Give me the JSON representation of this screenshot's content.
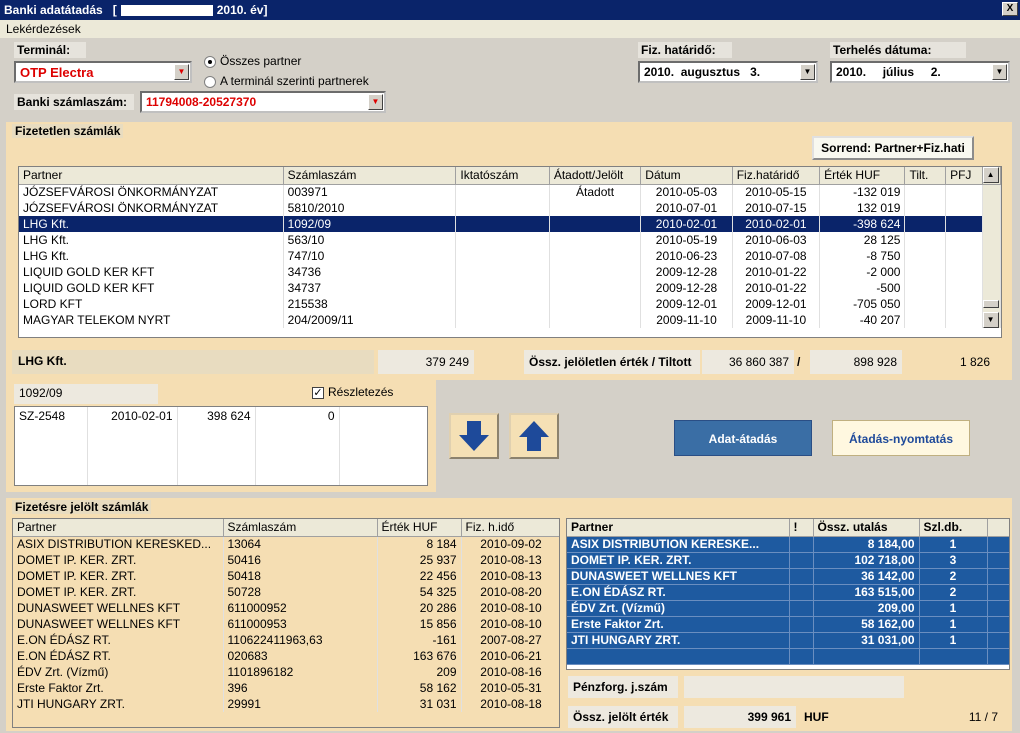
{
  "window": {
    "title_prefix": "Banki adatátadás",
    "title_bracket_open": "[",
    "title_suffix": "2010. év]",
    "close": "X"
  },
  "menu": {
    "item1": "Lekérdezések"
  },
  "terminal": {
    "label": "Terminál:",
    "value": "OTP Electra"
  },
  "radios": {
    "all_partners": "Összes partner",
    "terminal_partners": "A terminál szerinti partnerek"
  },
  "bank_account": {
    "label": "Banki számlaszám:",
    "value": "11794008-20527370"
  },
  "due_date": {
    "label": "Fiz. határidő:",
    "year": "2010.",
    "month": "augusztus",
    "day": "3."
  },
  "charge_date": {
    "label": "Terhelés dátuma:",
    "year": "2010.",
    "month": "július",
    "day": "2."
  },
  "unpaid": {
    "title": "Fizetetlen számlák",
    "sort_button": "Sorrend: Partner+Fiz.hati",
    "columns": [
      "Partner",
      "Számlaszám",
      "Iktatószám",
      "Átadott/Jelölt",
      "Dátum",
      "Fiz.határidő",
      "Érték HUF",
      "Tilt.",
      "PFJ"
    ],
    "rows": [
      [
        "JÓZSEFVÁROSI ÖNKORMÁNYZAT",
        "003971",
        "",
        "Átadott",
        "2010-05-03",
        "2010-05-15",
        "-132 019",
        "",
        ""
      ],
      [
        "JÓZSEFVÁROSI ÖNKORMÁNYZAT",
        "5810/2010",
        "",
        "",
        "2010-07-01",
        "2010-07-15",
        "132 019",
        "",
        ""
      ],
      [
        "LHG Kft.",
        "1092/09",
        "",
        "",
        "2010-02-01",
        "2010-02-01",
        "-398 624",
        "",
        ""
      ],
      [
        "LHG Kft.",
        "563/10",
        "",
        "",
        "2010-05-19",
        "2010-06-03",
        "28 125",
        "",
        ""
      ],
      [
        "LHG Kft.",
        "747/10",
        "",
        "",
        "2010-06-23",
        "2010-07-08",
        "-8 750",
        "",
        ""
      ],
      [
        "LIQUID GOLD KER KFT",
        "34736",
        "",
        "",
        "2009-12-28",
        "2010-01-22",
        "-2 000",
        "",
        ""
      ],
      [
        "LIQUID GOLD KER KFT",
        "34737",
        "",
        "",
        "2009-12-28",
        "2010-01-22",
        "-500",
        "",
        ""
      ],
      [
        "LORD KFT",
        "215538",
        "",
        "",
        "2009-12-01",
        "2009-12-01",
        "-705 050",
        "",
        ""
      ],
      [
        "MAGYAR TELEKOM NYRT",
        "204/2009/11",
        "",
        "",
        "2009-11-10",
        "2009-11-10",
        "-40 207",
        "",
        ""
      ]
    ],
    "selected_partner": "LHG Kft.",
    "selected_total": "379 249",
    "sum_label": "Össz. jelöletlen érték / Tiltott",
    "sum_value": "36 860 387",
    "sum_sep": "/",
    "blocked_value": "898 928",
    "count": "1 826"
  },
  "detail": {
    "invoice": "1092/09",
    "check_label": "Részletezés",
    "rows": [
      [
        "SZ-2548",
        "2010-02-01",
        "398 624",
        "0"
      ]
    ]
  },
  "buttons": {
    "transfer": "Adat-átadás",
    "print": "Átadás-nyomtatás"
  },
  "marked": {
    "title": "Fizetésre jelölt számlák",
    "columns": [
      "Partner",
      "Számlaszám",
      "Érték HUF",
      "Fiz. h.idő"
    ],
    "rows": [
      [
        "ASIX DISTRIBUTION KERESKED...",
        "13064",
        "8 184",
        "2010-09-02"
      ],
      [
        "DOMET IP. KER. ZRT.",
        "50416",
        "25 937",
        "2010-08-13"
      ],
      [
        "DOMET IP. KER. ZRT.",
        "50418",
        "22 456",
        "2010-08-13"
      ],
      [
        "DOMET IP. KER. ZRT.",
        "50728",
        "54 325",
        "2010-08-20"
      ],
      [
        "DUNASWEET WELLNES KFT",
        "611000952",
        "20 286",
        "2010-08-10"
      ],
      [
        "DUNASWEET WELLNES KFT",
        "611000953",
        "15 856",
        "2010-08-10"
      ],
      [
        "E.ON ÉDÁSZ RT.",
        "110622411963,63",
        "-161",
        "2007-08-27"
      ],
      [
        "E.ON ÉDÁSZ RT.",
        "020683",
        "163 676",
        "2010-06-21"
      ],
      [
        "ÉDV Zrt. (Vízmű)",
        "1101896182",
        "209",
        "2010-08-16"
      ],
      [
        "Erste Faktor Zrt.",
        "396",
        "58 162",
        "2010-05-31"
      ],
      [
        "JTI HUNGARY ZRT.",
        "29991",
        "31 031",
        "2010-08-18"
      ]
    ]
  },
  "summary": {
    "columns": [
      "Partner",
      "!",
      "Össz. utalás",
      "Szl.db."
    ],
    "rows": [
      [
        "ASIX DISTRIBUTION KERESKE...",
        "",
        "8 184,00",
        "1"
      ],
      [
        "DOMET IP. KER. ZRT.",
        "",
        "102 718,00",
        "3"
      ],
      [
        "DUNASWEET WELLNES KFT",
        "",
        "36 142,00",
        "2"
      ],
      [
        "E.ON ÉDÁSZ RT.",
        "",
        "163 515,00",
        "2"
      ],
      [
        "ÉDV Zrt. (Vízmű)",
        "",
        "209,00",
        "1"
      ],
      [
        "Erste Faktor Zrt.",
        "",
        "58 162,00",
        "1"
      ],
      [
        "JTI HUNGARY ZRT.",
        "",
        "31 031,00",
        "1"
      ]
    ],
    "cash_label": "Pénzforg. j.szám",
    "cash_value": "",
    "total_label": "Össz. jelölt érték",
    "total_value": "399 961",
    "currency": "HUF",
    "page": "11 / 7"
  }
}
